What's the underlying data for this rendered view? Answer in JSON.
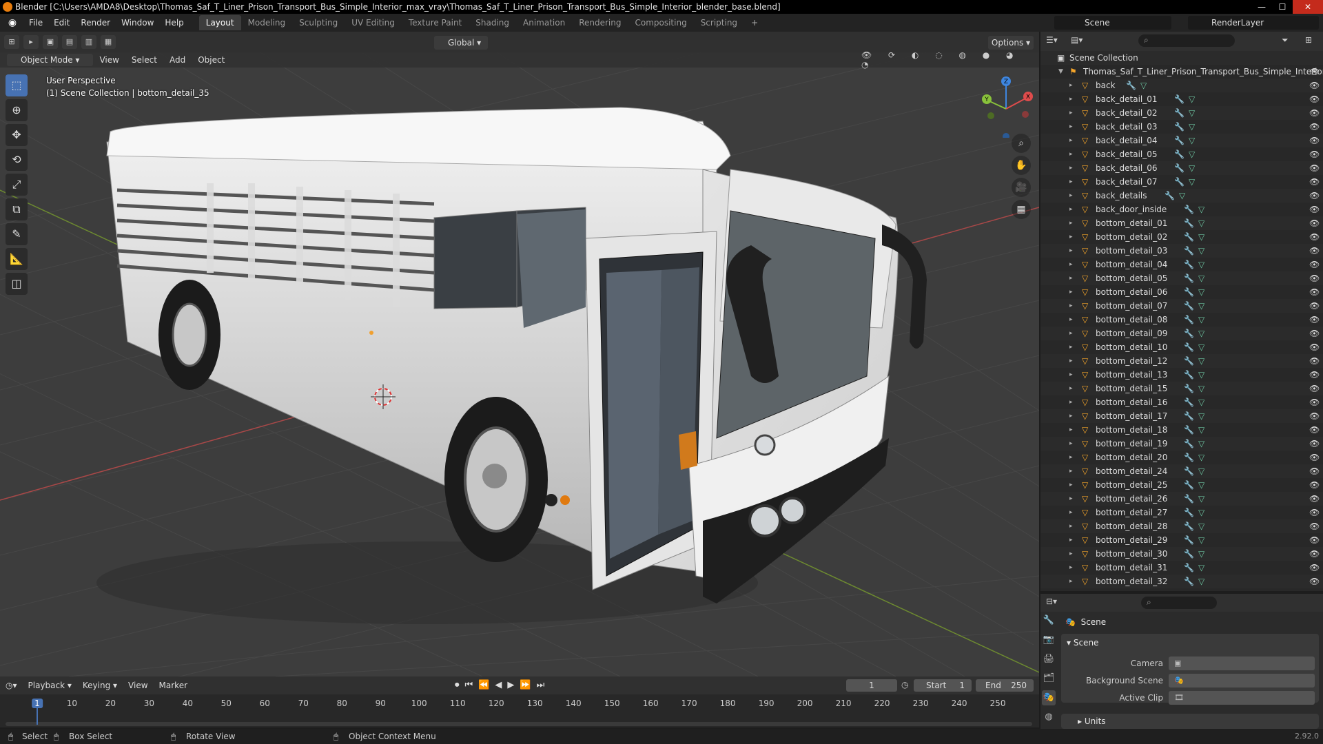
{
  "window": {
    "title": "Blender [C:\\Users\\AMDA8\\Desktop\\Thomas_Saf_T_Liner_Prison_Transport_Bus_Simple_Interior_max_vray\\Thomas_Saf_T_Liner_Prison_Transport_Bus_Simple_Interior_blender_base.blend]",
    "controls": [
      "minimize",
      "maximize",
      "close"
    ]
  },
  "menubar": {
    "items": [
      "File",
      "Edit",
      "Render",
      "Window",
      "Help"
    ],
    "workspaces": [
      "Layout",
      "Modeling",
      "Sculpting",
      "UV Editing",
      "Texture Paint",
      "Shading",
      "Animation",
      "Rendering",
      "Compositing",
      "Scripting"
    ],
    "active_workspace": "Layout",
    "scene": "Scene",
    "render_layer": "RenderLayer"
  },
  "tool_header": {
    "transform_orientation": "Global",
    "options_label": "Options"
  },
  "viewport_header": {
    "mode": "Object Mode",
    "menus": [
      "View",
      "Select",
      "Add",
      "Object"
    ]
  },
  "viewport": {
    "perspective": "User Perspective",
    "collection_info": "(1) Scene Collection | bottom_detail_35",
    "gizmo_axes": [
      "X",
      "Y",
      "Z"
    ],
    "colors": {
      "x_axis": "#e04c4c",
      "y_axis": "#89c23b",
      "z_axis": "#3e86e0",
      "grid": "#4a4a4a",
      "background": "#3d3d3d"
    }
  },
  "outliner": {
    "root": "Scene Collection",
    "collection": "Thomas_Saf_T_Liner_Prison_Transport_Bus_Simple_Interior",
    "objects": [
      "back",
      "back_detail_01",
      "back_detail_02",
      "back_detail_03",
      "back_detail_04",
      "back_detail_05",
      "back_detail_06",
      "back_detail_07",
      "back_details",
      "back_door_inside",
      "bottom_detail_01",
      "bottom_detail_02",
      "bottom_detail_03",
      "bottom_detail_04",
      "bottom_detail_05",
      "bottom_detail_06",
      "bottom_detail_07",
      "bottom_detail_08",
      "bottom_detail_09",
      "bottom_detail_10",
      "bottom_detail_12",
      "bottom_detail_13",
      "bottom_detail_15",
      "bottom_detail_16",
      "bottom_detail_17",
      "bottom_detail_18",
      "bottom_detail_19",
      "bottom_detail_20",
      "bottom_detail_24",
      "bottom_detail_25",
      "bottom_detail_26",
      "bottom_detail_27",
      "bottom_detail_28",
      "bottom_detail_29",
      "bottom_detail_30",
      "bottom_detail_31",
      "bottom_detail_32"
    ]
  },
  "properties": {
    "context": "Scene",
    "panel": "Scene",
    "fields": [
      {
        "label": "Camera",
        "value": ""
      },
      {
        "label": "Background Scene",
        "value": ""
      },
      {
        "label": "Active Clip",
        "value": ""
      }
    ],
    "collapsed_panel": "Units"
  },
  "timeline": {
    "menus": [
      "Playback",
      "Keying",
      "View",
      "Marker"
    ],
    "current_frame": "1",
    "start_label": "Start",
    "start": "1",
    "end_label": "End",
    "end": "250",
    "ticks": [
      "1",
      "10",
      "20",
      "30",
      "40",
      "50",
      "60",
      "70",
      "80",
      "90",
      "100",
      "110",
      "120",
      "130",
      "140",
      "150",
      "160",
      "170",
      "180",
      "190",
      "200",
      "210",
      "220",
      "230",
      "240",
      "250"
    ]
  },
  "statusbar": {
    "select": "Select",
    "box_select": "Box Select",
    "rotate_view": "Rotate View",
    "context_menu": "Object Context Menu",
    "version": "2.92.0"
  }
}
